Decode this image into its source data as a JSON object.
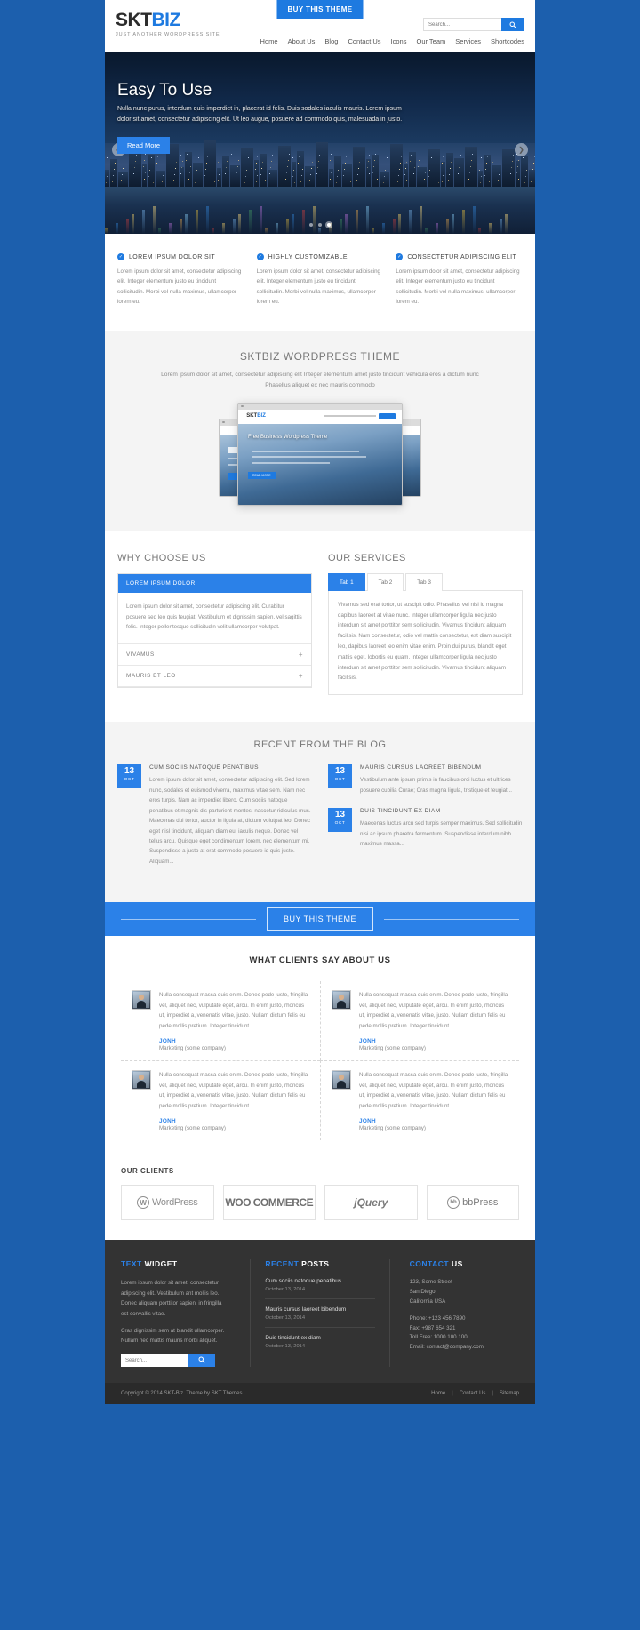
{
  "header": {
    "buy_top_label": "BUY THIS THEME",
    "logo_first": "SKT",
    "logo_second": "BIZ",
    "tagline": "JUST ANOTHER WORDPRESS SITE",
    "search_placeholder": "Search...",
    "search_icon": "search-icon",
    "nav": [
      {
        "label": "Home"
      },
      {
        "label": "About Us"
      },
      {
        "label": "Blog"
      },
      {
        "label": "Contact Us"
      },
      {
        "label": "Icons"
      },
      {
        "label": "Our Team"
      },
      {
        "label": "Services"
      },
      {
        "label": "Shortcodes"
      }
    ]
  },
  "slider": {
    "heading": "Easy To Use",
    "paragraph": "Nulla nunc purus, interdum quis imperdiet in, placerat id felis. Duis sodales iaculis mauris. Lorem ipsum dolor sit amet, consectetur adipiscing elit. Ut leo augue, posuere ad commodo quis, malesuada in justo.",
    "button_label": "Read More",
    "prev_icon": "chevron-left-icon",
    "next_icon": "chevron-right-icon",
    "dots": 3,
    "active_dot": 3
  },
  "features": [
    {
      "title": "LOREM IPSUM DOLOR SIT",
      "text": "Lorem ipsum dolor sit amet, consectetur adipiscing elit. Integer elementum justo eu tincidunt sollicitudin. Morbi vel nulla maximus, ullamcorper lorem eu."
    },
    {
      "title": "HIGHLY CUSTOMIZABLE",
      "text": "Lorem ipsum dolor sit amet, consectetur adipiscing elit. Integer elementum justo eu tincidunt sollicitudin. Morbi vel nulla maximus, ullamcorper lorem eu."
    },
    {
      "title": "CONSECTETUR ADIPISCING ELIT",
      "text": "Lorem ipsum dolor sit amet, consectetur adipiscing elit. Integer elementum justo eu tincidunt sollicitudin. Morbi vel nulla maximus, ullamcorper lorem eu."
    }
  ],
  "showcase": {
    "heading": "SKTBIZ WORDPRESS THEME",
    "text": "Lorem ipsum dolor sit amet, consectetur adipiscing elit Integer elementum amet justo tincidunt vehicula eros a dictum nunc Phasellus aliquet ex nec mauris commodo",
    "device_logo_first": "SKT",
    "device_logo_second": "BIZ",
    "device_heading": "Free Business Wordpress Theme",
    "device_button": "READ MORE"
  },
  "why_choose": {
    "heading": "WHY CHOOSE US",
    "items": [
      {
        "label": "LOREM IPSUM DOLOR",
        "open": true,
        "body": "Lorem ipsum dolor sit amet, consectetur adipiscing elit. Curabitur posuere sed leo quis feugiat. Vestibulum et dignissim sapien, vel sagittis felis. Integer pellentesque sollicitudin velit ullamcorper volutpat."
      },
      {
        "label": "VIVAMUS",
        "open": false,
        "toggle_icon": "plus-icon"
      },
      {
        "label": "MAURIS ET LEO",
        "open": false,
        "toggle_icon": "plus-icon"
      }
    ]
  },
  "services": {
    "heading": "OUR SERVICES",
    "tabs": [
      {
        "label": "Tab 1",
        "active": true
      },
      {
        "label": "Tab 2",
        "active": false
      },
      {
        "label": "Tab 3",
        "active": false
      }
    ],
    "panel_text": "Vivamus sed erat tortor, ut suscipit odio. Phasellus vel nisi id magna dapibus laoreet at vitae nunc. Integer ullamcorper ligula nec justo interdum sit amet porttitor sem sollicitudin. Vivamus tincidunt aliquam facilisis. Nam consectetur, odio vel mattis consectetur, est diam suscipit leo, dapibus laoreet leo enim vitae enim. Proin dui purus, blandit eget mattis eget, lobortis eu quam. Integer ullamcorper ligula nec justo interdum sit amet porttitor sem sollicitudin. Vivamus tincidunt aliquam facilisis."
  },
  "blog": {
    "heading": "RECENT FROM THE BLOG",
    "left_posts": [
      {
        "day": "13",
        "month": "OCT",
        "title": "CUM SOCIIS NATOQUE PENATIBUS",
        "excerpt": "Lorem ipsum dolor sit amet, consectetur adipiscing elit. Sed lorem nunc, sodales et euismod viverra, maximus vitae sem. Nam nec eros turpis. Nam ac imperdiet libero. Cum sociis natoque penatibus et magnis dis parturient montes, nascetur ridiculus mus. Maecenas dui tortor, auctor in ligula at, dictum volutpat leo. Donec eget nisl tincidunt, aliquam diam eu, iaculis neque. Donec vel tellus arcu. Quisque eget condimentum lorem, nec elementum mi. Suspendisse a justo at erat commodo posuere id quis justo. Aliquam..."
      }
    ],
    "right_posts": [
      {
        "day": "13",
        "month": "OCT",
        "title": "MAURIS CURSUS LAOREET BIBENDUM",
        "excerpt": "Vestibulum ante ipsum primis in faucibus orci luctus et ultrices posuere cubilia Curae; Cras magna ligula, tristique et feugiat..."
      },
      {
        "day": "13",
        "month": "OCT",
        "title": "DUIS TINCIDUNT EX DIAM",
        "excerpt": "Maecenas luctus arcu sed turpis semper maximus. Sed sollicitudin nisi ac ipsum pharetra fermentum. Suspendisse interdum nibh maximus massa..."
      }
    ]
  },
  "buy_band": {
    "label": "BUY THIS THEME"
  },
  "testimonials": {
    "heading": "WHAT CLIENTS SAY ABOUT US",
    "items": [
      {
        "quote": "Nulla consequat massa quis enim. Donec pede justo, fringilla vel, aliquet nec, vulputate eget, arcu. In enim justo, rhoncus ut, imperdiet a, venenatis vitae, justo. Nullam dictum felis eu pede mollis pretium. Integer tincidunt.",
        "name": "JONH",
        "role": "Marketing (some company)"
      },
      {
        "quote": "Nulla consequat massa quis enim. Donec pede justo, fringilla vel, aliquet nec, vulputate eget, arcu. In enim justo, rhoncus ut, imperdiet a, venenatis vitae, justo. Nullam dictum felis eu pede mollis pretium. Integer tincidunt.",
        "name": "JONH",
        "role": "Marketing (some company)"
      },
      {
        "quote": "Nulla consequat massa quis enim. Donec pede justo, fringilla vel, aliquet nec, vulputate eget, arcu. In enim justo, rhoncus ut, imperdiet a, venenatis vitae, justo. Nullam dictum felis eu pede mollis pretium. Integer tincidunt.",
        "name": "JONH",
        "role": "Marketing (some company)"
      },
      {
        "quote": "Nulla consequat massa quis enim. Donec pede justo, fringilla vel, aliquet nec, vulputate eget, arcu. In enim justo, rhoncus ut, imperdiet a, venenatis vitae, justo. Nullam dictum felis eu pede mollis pretium. Integer tincidunt.",
        "name": "JONH",
        "role": "Marketing (some company)"
      }
    ]
  },
  "clients": {
    "heading": "OUR CLIENTS",
    "logos": [
      {
        "name": "WordPress",
        "mark": "W"
      },
      {
        "name": "WOO COMMERCE",
        "mark": ""
      },
      {
        "name": "jQuery",
        "mark": ""
      },
      {
        "name": "bbPress",
        "mark": "bb"
      }
    ]
  },
  "footer": {
    "widget": {
      "title_first": "TEXT",
      "title_second": "WIDGET",
      "paragraph1": "Lorem ipsum dolor sit amet, consectetur adipiscing elit. Vestibulum ant mollis leo. Donec aliquam porttitor sapien, in fringilla est convallis vitae.",
      "paragraph2": "Cras dignissim sem at blandit ullamcorper. Nullam nec mattis mauris morbi aliquet.",
      "search_placeholder": "Search...",
      "search_icon": "search-icon"
    },
    "recent": {
      "title_first": "RECENT",
      "title_second": "POSTS",
      "posts": [
        {
          "title": "Cum sociis natoque penatibus",
          "date": "October 13, 2014"
        },
        {
          "title": "Mauris cursus laoreet bibendum",
          "date": "October 13, 2014"
        },
        {
          "title": "Duis tincidunt ex diam",
          "date": "October 13, 2014"
        }
      ]
    },
    "contact": {
      "title_first": "CONTACT",
      "title_second": "US",
      "address": [
        "123, Some Street",
        "San Diego",
        "California USA"
      ],
      "details": [
        "Phone: +123 456 7890",
        "Fax: +987 654 321",
        "Toll Free: 1000 100 100",
        "Email: contact@company.com"
      ]
    }
  },
  "bottombar": {
    "copyright": "Copyright © 2014 SKT-Biz. Theme by  SKT Themes .",
    "links": [
      {
        "label": "Home"
      },
      {
        "label": "Contact Us"
      },
      {
        "label": "Sitemap"
      }
    ]
  },
  "colors": {
    "accent": "#2b81e8",
    "page_bg": "#1c5fad",
    "footer_bg": "#333333"
  }
}
